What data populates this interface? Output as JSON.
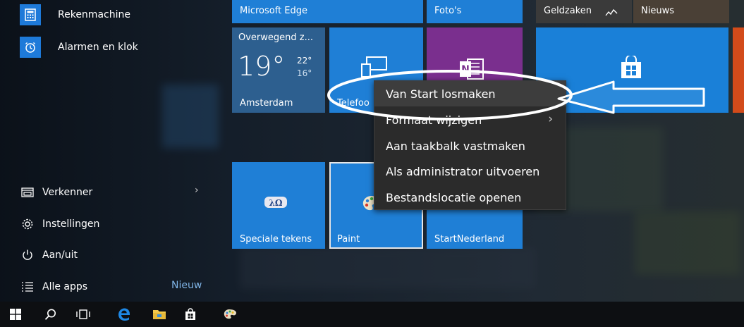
{
  "left_apps": [
    {
      "label": "Rekenmachine",
      "icon": "calculator-icon"
    },
    {
      "label": "Alarmen en klok",
      "icon": "alarm-clock-icon"
    }
  ],
  "left_system": [
    {
      "label": "Verkenner",
      "icon": "file-explorer-icon"
    },
    {
      "label": "Instellingen",
      "icon": "gear-icon"
    },
    {
      "label": "Aan/uit",
      "icon": "power-icon"
    },
    {
      "label": "Alle apps",
      "icon": "list-icon"
    }
  ],
  "all_apps_badge": "Nieuw",
  "tiles": {
    "edge": "Microsoft Edge",
    "photos": "Foto's",
    "money": "Geldzaken",
    "news": "Nieuws",
    "weather": {
      "condition": "Overwegend z...",
      "temp": "19°",
      "high": "22°",
      "low": "16°",
      "city": "Amsterdam"
    },
    "phone": "Telefoo",
    "special_chars": "Speciale tekens",
    "paint": "Paint",
    "startnederland": "StartNederland"
  },
  "context_menu": [
    {
      "label": "Van Start losmaken",
      "highlighted": true
    },
    {
      "label": "Formaat wijzigen",
      "submenu": true
    },
    {
      "label": "Aan taakbalk vastmaken"
    },
    {
      "label": "Als administrator uitvoeren"
    },
    {
      "label": "Bestandslocatie openen"
    }
  ],
  "taskbar": [
    "windows-start-icon",
    "search-icon",
    "task-view-icon",
    "edge-icon",
    "file-explorer-icon",
    "store-icon",
    "paint-icon"
  ],
  "colors": {
    "tile_blue": "#1f7fd6",
    "onenote_purple": "#7a2f8e",
    "store_blue": "#1a80d8",
    "weather_blue": "#2d5f8f"
  }
}
